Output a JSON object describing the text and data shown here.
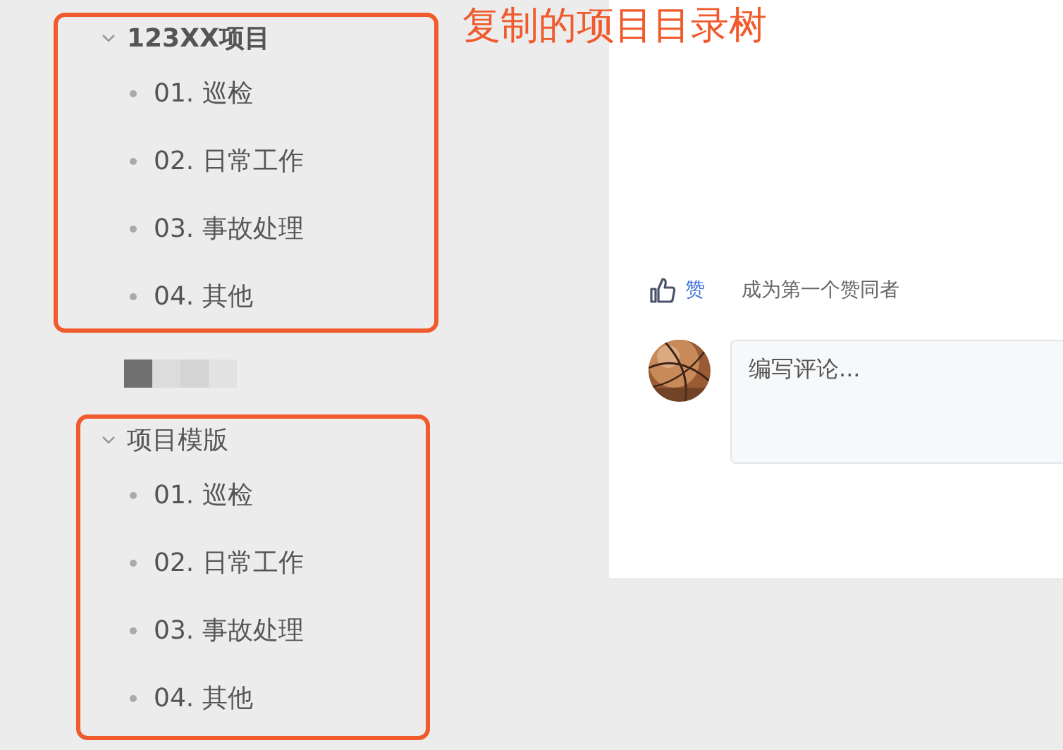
{
  "annotation": "复制的项目目录树",
  "tree": [
    {
      "title": "123XX项目",
      "selected": true,
      "expanded": true,
      "highlighted": true,
      "children": [
        {
          "title": "01. 巡检"
        },
        {
          "title": "02. 日常工作"
        },
        {
          "title": "03. 事故处理"
        },
        {
          "title": "04. 其他"
        }
      ]
    },
    {
      "title": "项目模版",
      "selected": false,
      "expanded": true,
      "highlighted": true,
      "children": [
        {
          "title": "01. 巡检"
        },
        {
          "title": "02. 日常工作"
        },
        {
          "title": "03. 事故处理"
        },
        {
          "title": "04. 其他"
        }
      ]
    }
  ],
  "likes": {
    "button": "赞",
    "text": "成为第一个赞同者"
  },
  "comment": {
    "placeholder": "编写评论..."
  }
}
